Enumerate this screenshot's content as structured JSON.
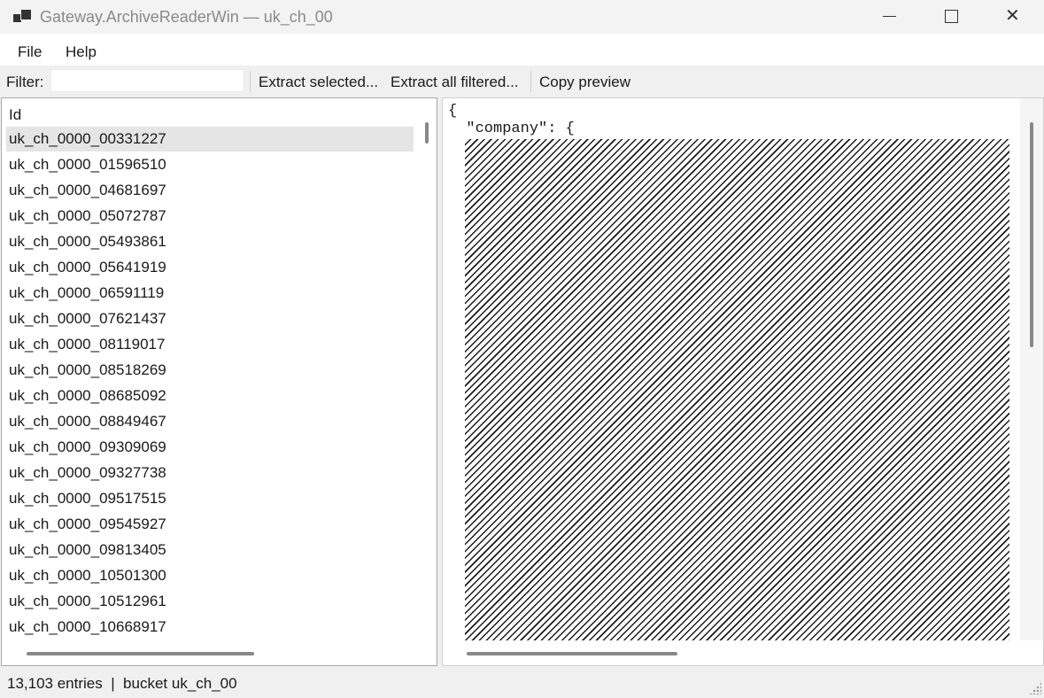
{
  "window": {
    "title": "Gateway.ArchiveReaderWin — uk_ch_00"
  },
  "menu": {
    "items": [
      "File",
      "Help"
    ]
  },
  "toolbar": {
    "filter_label": "Filter:",
    "filter_value": "",
    "extract_selected": "Extract selected...",
    "extract_all_filtered": "Extract all filtered...",
    "copy_preview": "Copy preview"
  },
  "list": {
    "header": "Id",
    "selected_index": 0,
    "rows": [
      "uk_ch_0000_00331227",
      "uk_ch_0000_01596510",
      "uk_ch_0000_04681697",
      "uk_ch_0000_05072787",
      "uk_ch_0000_05493861",
      "uk_ch_0000_05641919",
      "uk_ch_0000_06591119",
      "uk_ch_0000_07621437",
      "uk_ch_0000_08119017",
      "uk_ch_0000_08518269",
      "uk_ch_0000_08685092",
      "uk_ch_0000_08849467",
      "uk_ch_0000_09309069",
      "uk_ch_0000_09327738",
      "uk_ch_0000_09517515",
      "uk_ch_0000_09545927",
      "uk_ch_0000_09813405",
      "uk_ch_0000_10501300",
      "uk_ch_0000_10512961",
      "uk_ch_0000_10668917"
    ]
  },
  "preview": {
    "line1": "{",
    "line2": "  \"company\": {"
  },
  "status": {
    "text": "13,103 entries  |  bucket uk_ch_00"
  }
}
